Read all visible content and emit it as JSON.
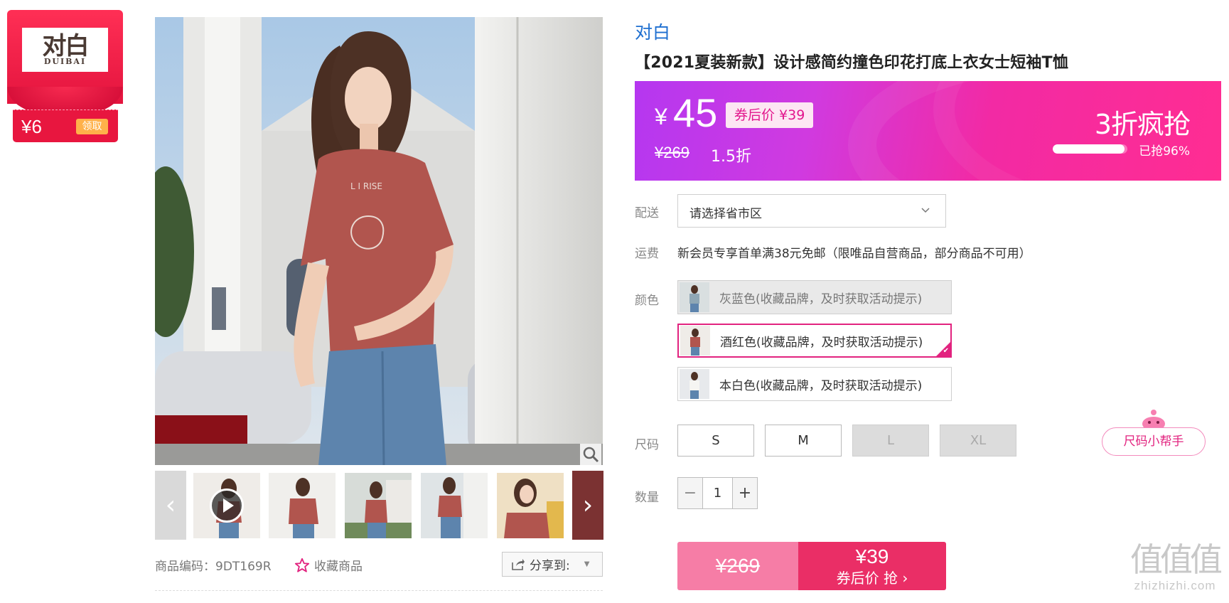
{
  "brand_badge": {
    "logo_text": "对白",
    "logo_subtext": "DUIBAI",
    "coupon_value": "¥6",
    "coupon_button": "领取"
  },
  "gallery": {
    "thumb_count": 6,
    "prev_arrow": "‹",
    "next_arrow": "›"
  },
  "meta": {
    "sku": "商品编码：9DT169R",
    "favorite_label": "收藏商品",
    "share_label": "分享到:"
  },
  "product": {
    "brand": "对白",
    "title": "【2021夏装新款】设计感简约撞色印花打底上衣女士短袖T恤"
  },
  "price": {
    "currency": "¥",
    "value": "45",
    "coupon_price": "券后价 ¥39",
    "original": "¥269",
    "discount": "1.5折",
    "flash_label": "3折疯抢",
    "sold_percent": 96,
    "sold_text": "已抢96%",
    "colors": {
      "banner_start": "#b537f0",
      "banner_end": "#ff2d92"
    }
  },
  "delivery": {
    "label": "配送",
    "placeholder": "请选择省市区"
  },
  "shipping": {
    "label": "运费",
    "text": "新会员专享首单满38元免邮（限唯品自营商品，部分商品不可用）"
  },
  "color": {
    "label": "颜色",
    "options": [
      {
        "text": "灰蓝色(收藏品牌，及时获取活动提示)",
        "state": "disabled"
      },
      {
        "text": "酒红色(收藏品牌，及时获取活动提示)",
        "state": "selected"
      },
      {
        "text": "本白色(收藏品牌，及时获取活动提示)",
        "state": "available"
      }
    ]
  },
  "size": {
    "label": "尺码",
    "options": [
      {
        "text": "S",
        "state": "available"
      },
      {
        "text": "M",
        "state": "available"
      },
      {
        "text": "L",
        "state": "disabled"
      },
      {
        "text": "XL",
        "state": "disabled"
      }
    ],
    "helper": "尺码小帮手"
  },
  "quantity": {
    "label": "数量",
    "minus": "−",
    "value": "1",
    "plus": "+"
  },
  "buy": {
    "original": "¥269",
    "coupon_price": "¥39",
    "coupon_action": "券后价 抢 ›"
  },
  "watermark": {
    "main": "值值值",
    "url": "zhizhizhi.com"
  }
}
